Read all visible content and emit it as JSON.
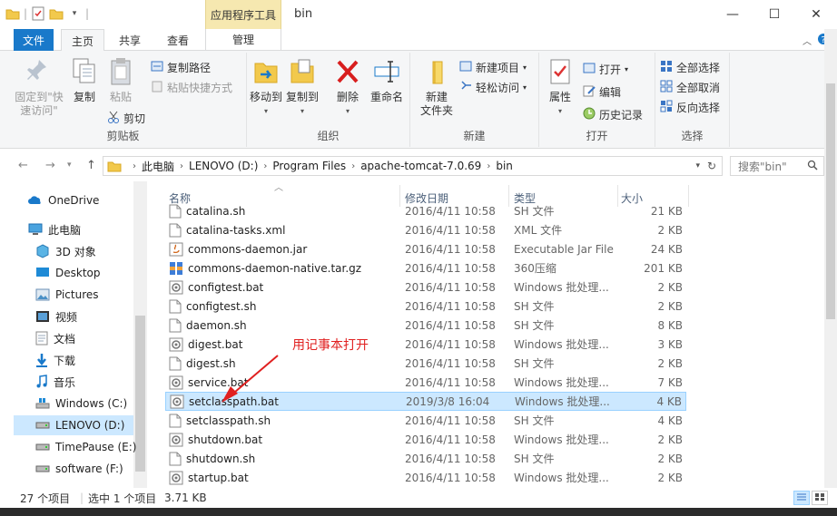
{
  "titlebar": {
    "context_tab": "应用程序工具",
    "title": "bin",
    "minimize": "—",
    "maximize": "☐",
    "close": "✕"
  },
  "tabs": {
    "file": "文件",
    "home": "主页",
    "share": "共享",
    "view": "查看",
    "manage": "管理"
  },
  "ribbon": {
    "clipboard": {
      "label": "剪贴板",
      "pin_quick": "固定到\"快\n速访问\"",
      "copy": "复制",
      "paste": "粘贴",
      "copy_path": "复制路径",
      "paste_shortcut": "粘贴快捷方式",
      "cut": "剪切"
    },
    "organize": {
      "label": "组织",
      "move_to": "移动到",
      "copy_to": "复制到",
      "delete": "删除",
      "rename": "重命名"
    },
    "new": {
      "label": "新建",
      "new_folder": "新建\n文件夹",
      "new_item": "新建项目",
      "easy_access": "轻松访问"
    },
    "open": {
      "label": "打开",
      "properties": "属性",
      "open": "打开",
      "edit": "编辑",
      "history": "历史记录"
    },
    "select": {
      "label": "选择",
      "select_all": "全部选择",
      "select_none": "全部取消",
      "invert": "反向选择"
    }
  },
  "address": {
    "path": [
      "此电脑",
      "LENOVO (D:)",
      "Program Files",
      "apache-tomcat-7.0.69",
      "bin"
    ],
    "search_placeholder": "搜索\"bin\""
  },
  "nav": [
    {
      "label": "OneDrive",
      "icon": "onedrive-icon",
      "selected": false
    },
    {
      "label": "此电脑",
      "icon": "computer-icon",
      "selected": false
    },
    {
      "label": "3D 对象",
      "icon": "cube-icon",
      "selected": false
    },
    {
      "label": "Desktop",
      "icon": "desktop-icon",
      "selected": false
    },
    {
      "label": "Pictures",
      "icon": "pictures-icon",
      "selected": false
    },
    {
      "label": "视频",
      "icon": "video-icon",
      "selected": false
    },
    {
      "label": "文档",
      "icon": "document-icon",
      "selected": false
    },
    {
      "label": "下载",
      "icon": "download-icon",
      "selected": false
    },
    {
      "label": "音乐",
      "icon": "music-icon",
      "selected": false
    },
    {
      "label": "Windows (C:)",
      "icon": "windows-drive-icon",
      "selected": false
    },
    {
      "label": "LENOVO (D:)",
      "icon": "drive-icon",
      "selected": true
    },
    {
      "label": "TimePause (E:)",
      "icon": "drive-icon",
      "selected": false
    },
    {
      "label": "software (F:)",
      "icon": "drive-icon",
      "selected": false
    }
  ],
  "columns": {
    "name": "名称",
    "date": "修改日期",
    "type": "类型",
    "size": "大小"
  },
  "files": [
    {
      "name": "catalina.sh",
      "date": "2016/4/11 10:58",
      "type": "SH 文件",
      "size": "21 KB",
      "icon": "file-icon",
      "selected": false
    },
    {
      "name": "catalina-tasks.xml",
      "date": "2016/4/11 10:58",
      "type": "XML 文件",
      "size": "2 KB",
      "icon": "file-icon",
      "selected": false
    },
    {
      "name": "commons-daemon.jar",
      "date": "2016/4/11 10:58",
      "type": "Executable Jar File",
      "size": "24 KB",
      "icon": "jar-icon",
      "selected": false
    },
    {
      "name": "commons-daemon-native.tar.gz",
      "date": "2016/4/11 10:58",
      "type": "360压缩",
      "size": "201 KB",
      "icon": "archive-icon",
      "selected": false
    },
    {
      "name": "configtest.bat",
      "date": "2016/4/11 10:58",
      "type": "Windows 批处理...",
      "size": "2 KB",
      "icon": "bat-icon",
      "selected": false
    },
    {
      "name": "configtest.sh",
      "date": "2016/4/11 10:58",
      "type": "SH 文件",
      "size": "2 KB",
      "icon": "file-icon",
      "selected": false
    },
    {
      "name": "daemon.sh",
      "date": "2016/4/11 10:58",
      "type": "SH 文件",
      "size": "8 KB",
      "icon": "file-icon",
      "selected": false
    },
    {
      "name": "digest.bat",
      "date": "2016/4/11 10:58",
      "type": "Windows 批处理...",
      "size": "3 KB",
      "icon": "bat-icon",
      "selected": false
    },
    {
      "name": "digest.sh",
      "date": "2016/4/11 10:58",
      "type": "SH 文件",
      "size": "2 KB",
      "icon": "file-icon",
      "selected": false
    },
    {
      "name": "service.bat",
      "date": "2016/4/11 10:58",
      "type": "Windows 批处理...",
      "size": "7 KB",
      "icon": "bat-icon",
      "selected": false
    },
    {
      "name": "setclasspath.bat",
      "date": "2019/3/8 16:04",
      "type": "Windows 批处理...",
      "size": "4 KB",
      "icon": "bat-icon",
      "selected": true
    },
    {
      "name": "setclasspath.sh",
      "date": "2016/4/11 10:58",
      "type": "SH 文件",
      "size": "4 KB",
      "icon": "file-icon",
      "selected": false
    },
    {
      "name": "shutdown.bat",
      "date": "2016/4/11 10:58",
      "type": "Windows 批处理...",
      "size": "2 KB",
      "icon": "bat-icon",
      "selected": false
    },
    {
      "name": "shutdown.sh",
      "date": "2016/4/11 10:58",
      "type": "SH 文件",
      "size": "2 KB",
      "icon": "file-icon",
      "selected": false
    },
    {
      "name": "startup.bat",
      "date": "2016/4/11 10:58",
      "type": "Windows 批处理...",
      "size": "2 KB",
      "icon": "bat-icon",
      "selected": false
    }
  ],
  "annotation": "用记事本打开",
  "status": {
    "count": "27 个项目",
    "selected": "选中 1 个项目",
    "size": "3.71 KB"
  },
  "colors": {
    "file_tab": "#1979ca",
    "selection": "#cce8ff",
    "annotation": "#e02020",
    "context_tab": "#f6e8b0"
  }
}
